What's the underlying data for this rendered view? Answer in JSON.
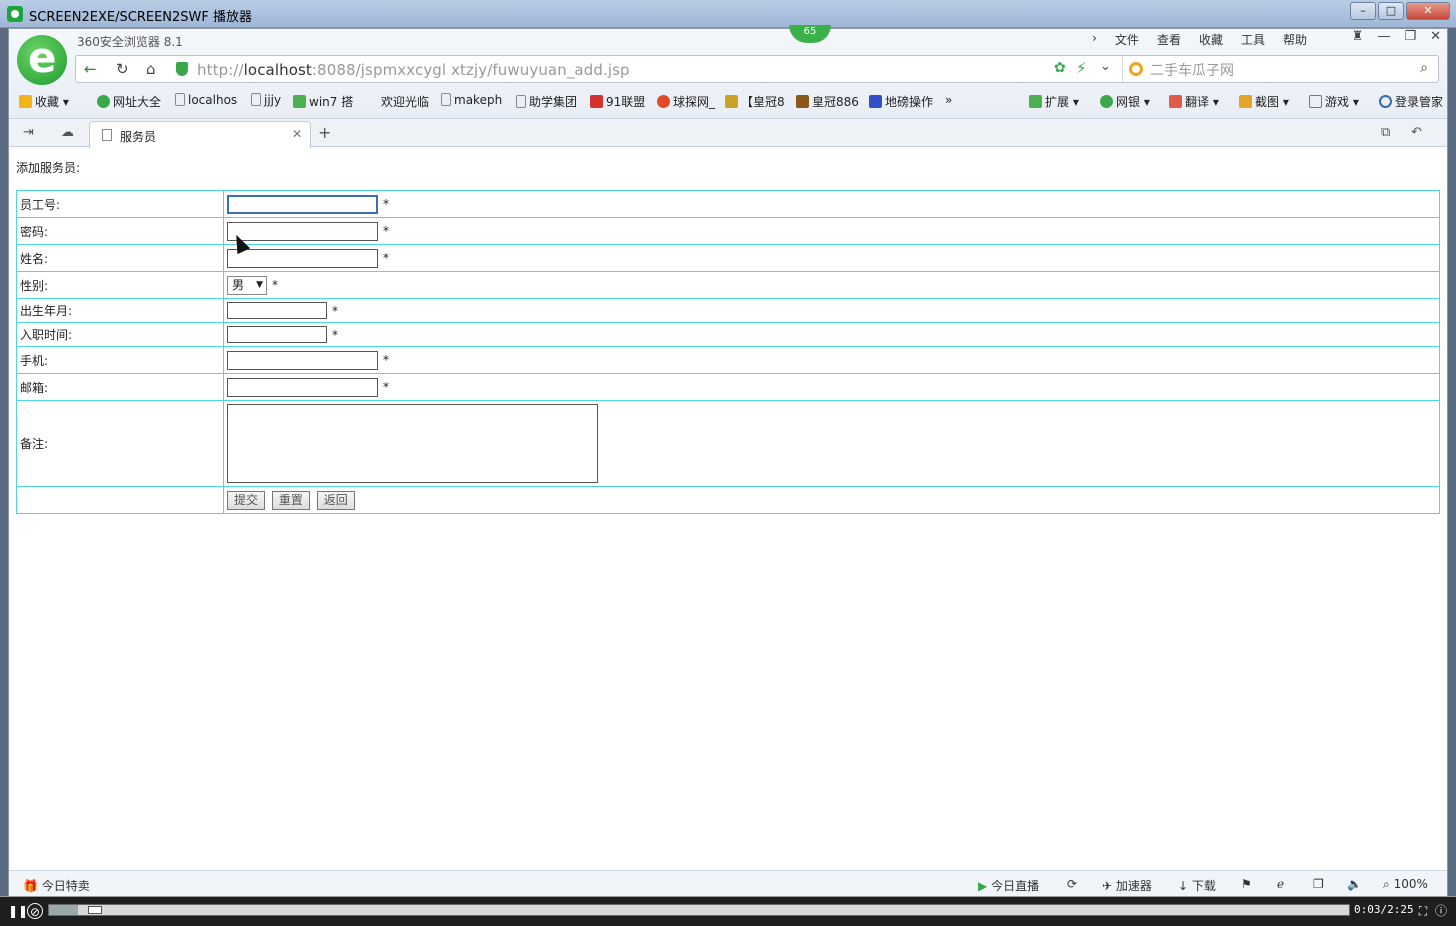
{
  "window": {
    "title": "SCREEN2EXE/SCREEN2SWF 播放器"
  },
  "browser": {
    "name": "360安全浏览器 8.1",
    "badge": "65",
    "menu": [
      "文件",
      "查看",
      "收藏",
      "工具",
      "帮助"
    ],
    "url_prefix": "http://",
    "url_host": "localhost",
    "url_rest": ":8088/jspmxxcygl xtzjy/fuwuyuan_add.jsp",
    "search_placeholder": "二手车瓜子网",
    "bookmarks": [
      {
        "label": "收藏",
        "icon": "star-icon",
        "color": "#f2b31b"
      },
      {
        "label": "网址大全",
        "icon": "portal-icon",
        "color": "#3aa84a"
      },
      {
        "label": "localhos",
        "icon": "page-icon",
        "color": "#ffffff"
      },
      {
        "label": "jjjy",
        "icon": "page-icon",
        "color": "#ffffff"
      },
      {
        "label": "win7 搭",
        "icon": "win7-icon",
        "color": "#4caf50"
      },
      {
        "label": "欢迎光临",
        "icon": "none",
        "color": "#ffffff"
      },
      {
        "label": "makeph",
        "icon": "page-icon",
        "color": "#ffffff"
      },
      {
        "label": "助学集团",
        "icon": "page-icon",
        "color": "#ffffff"
      },
      {
        "label": "91联盟",
        "icon": "union-icon",
        "color": "#d6322f"
      },
      {
        "label": "球探网_",
        "icon": "ball-icon",
        "color": "#e04a2a"
      },
      {
        "label": "【皇冠8",
        "icon": "crown-icon",
        "color": "#c9a227"
      },
      {
        "label": "皇冠886",
        "icon": "crown-icon",
        "color": "#8a5a1a"
      },
      {
        "label": "地磅操作",
        "icon": "paw-icon",
        "color": "#3250c8"
      }
    ],
    "toolbar_right": [
      "扩展",
      "网银",
      "翻译",
      "截图",
      "游戏",
      "登录管家"
    ],
    "tab_label": "服务员",
    "status_left": "今日特卖",
    "status_right": [
      "今日直播",
      "加速器",
      "下载",
      "100%"
    ]
  },
  "form": {
    "page_title": "添加服务员:",
    "required_mark": "*",
    "fields": {
      "emp_no": "员工号:",
      "password": "密码:",
      "name": "姓名:",
      "gender": "性别:",
      "birth": "出生年月:",
      "hire_date": "入职时间:",
      "phone": "手机:",
      "email": "邮箱:",
      "note": "备注:"
    },
    "gender_selected": "男",
    "buttons": {
      "submit": "提交",
      "reset": "重置",
      "back": "返回"
    }
  },
  "player": {
    "time": "0:03/2:25",
    "progress": 0.022
  }
}
